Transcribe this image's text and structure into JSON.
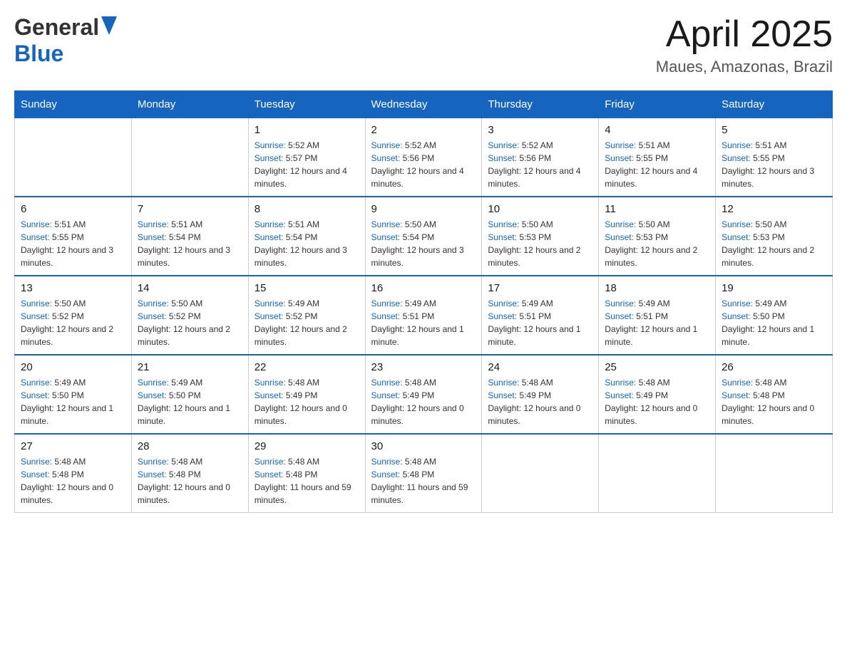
{
  "header": {
    "logo_general": "General",
    "logo_blue": "Blue",
    "month_title": "April 2025",
    "location": "Maues, Amazonas, Brazil"
  },
  "columns": [
    "Sunday",
    "Monday",
    "Tuesday",
    "Wednesday",
    "Thursday",
    "Friday",
    "Saturday"
  ],
  "weeks": [
    [
      {
        "day": "",
        "sunrise": "",
        "sunset": "",
        "daylight": ""
      },
      {
        "day": "",
        "sunrise": "",
        "sunset": "",
        "daylight": ""
      },
      {
        "day": "1",
        "sunrise": "5:52 AM",
        "sunset": "5:57 PM",
        "daylight": "12 hours and 4 minutes."
      },
      {
        "day": "2",
        "sunrise": "5:52 AM",
        "sunset": "5:56 PM",
        "daylight": "12 hours and 4 minutes."
      },
      {
        "day": "3",
        "sunrise": "5:52 AM",
        "sunset": "5:56 PM",
        "daylight": "12 hours and 4 minutes."
      },
      {
        "day": "4",
        "sunrise": "5:51 AM",
        "sunset": "5:55 PM",
        "daylight": "12 hours and 4 minutes."
      },
      {
        "day": "5",
        "sunrise": "5:51 AM",
        "sunset": "5:55 PM",
        "daylight": "12 hours and 3 minutes."
      }
    ],
    [
      {
        "day": "6",
        "sunrise": "5:51 AM",
        "sunset": "5:55 PM",
        "daylight": "12 hours and 3 minutes."
      },
      {
        "day": "7",
        "sunrise": "5:51 AM",
        "sunset": "5:54 PM",
        "daylight": "12 hours and 3 minutes."
      },
      {
        "day": "8",
        "sunrise": "5:51 AM",
        "sunset": "5:54 PM",
        "daylight": "12 hours and 3 minutes."
      },
      {
        "day": "9",
        "sunrise": "5:50 AM",
        "sunset": "5:54 PM",
        "daylight": "12 hours and 3 minutes."
      },
      {
        "day": "10",
        "sunrise": "5:50 AM",
        "sunset": "5:53 PM",
        "daylight": "12 hours and 2 minutes."
      },
      {
        "day": "11",
        "sunrise": "5:50 AM",
        "sunset": "5:53 PM",
        "daylight": "12 hours and 2 minutes."
      },
      {
        "day": "12",
        "sunrise": "5:50 AM",
        "sunset": "5:53 PM",
        "daylight": "12 hours and 2 minutes."
      }
    ],
    [
      {
        "day": "13",
        "sunrise": "5:50 AM",
        "sunset": "5:52 PM",
        "daylight": "12 hours and 2 minutes."
      },
      {
        "day": "14",
        "sunrise": "5:50 AM",
        "sunset": "5:52 PM",
        "daylight": "12 hours and 2 minutes."
      },
      {
        "day": "15",
        "sunrise": "5:49 AM",
        "sunset": "5:52 PM",
        "daylight": "12 hours and 2 minutes."
      },
      {
        "day": "16",
        "sunrise": "5:49 AM",
        "sunset": "5:51 PM",
        "daylight": "12 hours and 1 minute."
      },
      {
        "day": "17",
        "sunrise": "5:49 AM",
        "sunset": "5:51 PM",
        "daylight": "12 hours and 1 minute."
      },
      {
        "day": "18",
        "sunrise": "5:49 AM",
        "sunset": "5:51 PM",
        "daylight": "12 hours and 1 minute."
      },
      {
        "day": "19",
        "sunrise": "5:49 AM",
        "sunset": "5:50 PM",
        "daylight": "12 hours and 1 minute."
      }
    ],
    [
      {
        "day": "20",
        "sunrise": "5:49 AM",
        "sunset": "5:50 PM",
        "daylight": "12 hours and 1 minute."
      },
      {
        "day": "21",
        "sunrise": "5:49 AM",
        "sunset": "5:50 PM",
        "daylight": "12 hours and 1 minute."
      },
      {
        "day": "22",
        "sunrise": "5:48 AM",
        "sunset": "5:49 PM",
        "daylight": "12 hours and 0 minutes."
      },
      {
        "day": "23",
        "sunrise": "5:48 AM",
        "sunset": "5:49 PM",
        "daylight": "12 hours and 0 minutes."
      },
      {
        "day": "24",
        "sunrise": "5:48 AM",
        "sunset": "5:49 PM",
        "daylight": "12 hours and 0 minutes."
      },
      {
        "day": "25",
        "sunrise": "5:48 AM",
        "sunset": "5:49 PM",
        "daylight": "12 hours and 0 minutes."
      },
      {
        "day": "26",
        "sunrise": "5:48 AM",
        "sunset": "5:48 PM",
        "daylight": "12 hours and 0 minutes."
      }
    ],
    [
      {
        "day": "27",
        "sunrise": "5:48 AM",
        "sunset": "5:48 PM",
        "daylight": "12 hours and 0 minutes."
      },
      {
        "day": "28",
        "sunrise": "5:48 AM",
        "sunset": "5:48 PM",
        "daylight": "12 hours and 0 minutes."
      },
      {
        "day": "29",
        "sunrise": "5:48 AM",
        "sunset": "5:48 PM",
        "daylight": "11 hours and 59 minutes."
      },
      {
        "day": "30",
        "sunrise": "5:48 AM",
        "sunset": "5:48 PM",
        "daylight": "11 hours and 59 minutes."
      },
      {
        "day": "",
        "sunrise": "",
        "sunset": "",
        "daylight": ""
      },
      {
        "day": "",
        "sunrise": "",
        "sunset": "",
        "daylight": ""
      },
      {
        "day": "",
        "sunrise": "",
        "sunset": "",
        "daylight": ""
      }
    ]
  ],
  "labels": {
    "sunrise": "Sunrise: ",
    "sunset": "Sunset: ",
    "daylight": "Daylight: "
  }
}
